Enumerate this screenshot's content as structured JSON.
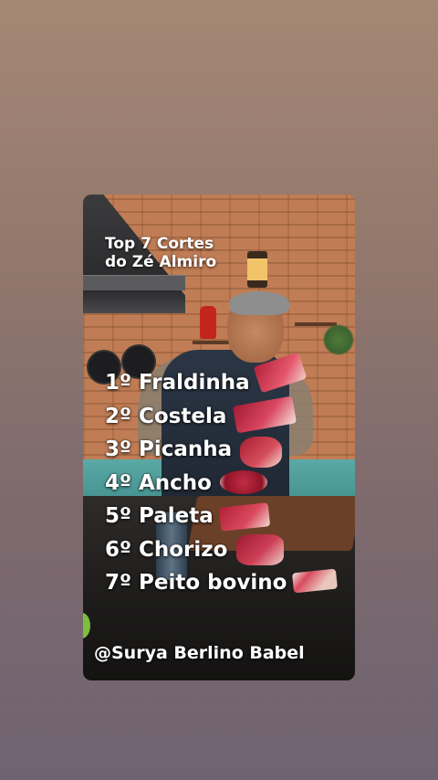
{
  "video": {
    "title_lines": [
      "Top 7 Cortes",
      "do Zé Almiro"
    ],
    "ranking": [
      {
        "rank": "1º",
        "cut": "Fraldinha"
      },
      {
        "rank": "2º",
        "cut": "Costela"
      },
      {
        "rank": "3º",
        "cut": "Picanha"
      },
      {
        "rank": "4º",
        "cut": "Ancho"
      },
      {
        "rank": "5º",
        "cut": "Paleta"
      },
      {
        "rank": "6º",
        "cut": "Chorizo"
      },
      {
        "rank": "7º",
        "cut": "Peito bovino"
      }
    ],
    "credit_handle": "@Surya Berlino Babel"
  },
  "colors": {
    "background_top": "#a58775",
    "background_bottom": "#6f6372",
    "overlay_text": "#ffffff"
  }
}
